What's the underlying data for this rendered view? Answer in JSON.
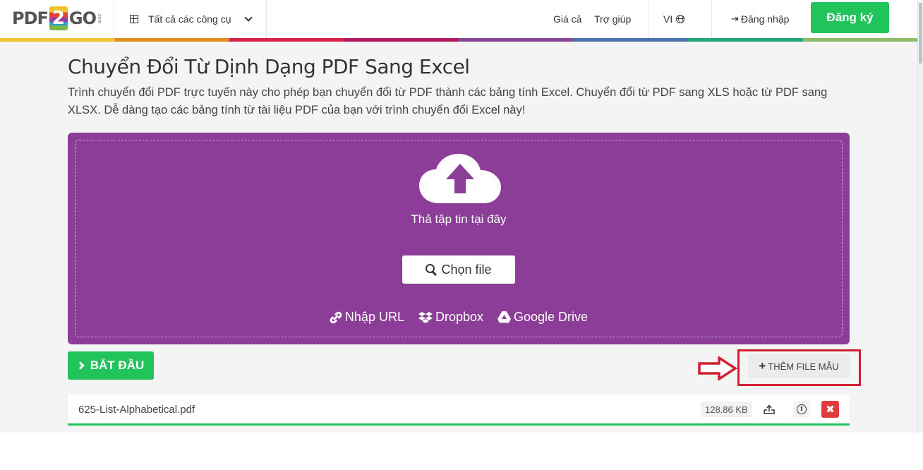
{
  "header": {
    "logo": {
      "left": "PDF",
      "digit": "2",
      "right": "GO",
      "suffix": ".com"
    },
    "tools_label": "Tất cả các công cụ",
    "pricing_label": "Giá cả",
    "help_label": "Trợ giúp",
    "language_label": "VI",
    "login_label": "Đăng nhập",
    "signup_label": "Đăng ký",
    "rainbow_colors": [
      "#f2c233",
      "#df8e23",
      "#d6234b",
      "#b0195e",
      "#894895",
      "#4a72ad",
      "#26a680",
      "#8cbd6a"
    ]
  },
  "page": {
    "title": "Chuyển Đổi Từ Dịnh Dạng PDF Sang Excel",
    "description": "Trình chuyển đổi PDF trực tuyến này cho phép bạn chuyển đổi từ PDF thành các bảng tính Excel. Chuyển đổi từ PDF sang XLS hoặc từ PDF sang XLSX. Dễ dàng tạo các bảng tính từ tài liệu PDF của bạn với trình chuyển đổi Excel này!"
  },
  "dropzone": {
    "drop_text": "Thả tập tin tại đây",
    "choose_file_label": "Chọn file",
    "sources": [
      {
        "icon": "link-icon",
        "label": "Nhập URL"
      },
      {
        "icon": "dropbox-icon",
        "label": "Dropbox"
      },
      {
        "icon": "google-drive-icon",
        "label": "Google Drive"
      }
    ],
    "accent": "#8b3d97"
  },
  "actions": {
    "start_label": "BẮT ĐẦU",
    "sample_label": "THÊM FILE MẪU"
  },
  "files": [
    {
      "name": "625-List-Alphabetical.pdf",
      "size": "128.86 KB",
      "progress_percent": 100
    }
  ],
  "colors": {
    "primary_green": "#21c35b",
    "danger_red": "#e33a3e",
    "annotation_red": "#d0212e"
  }
}
